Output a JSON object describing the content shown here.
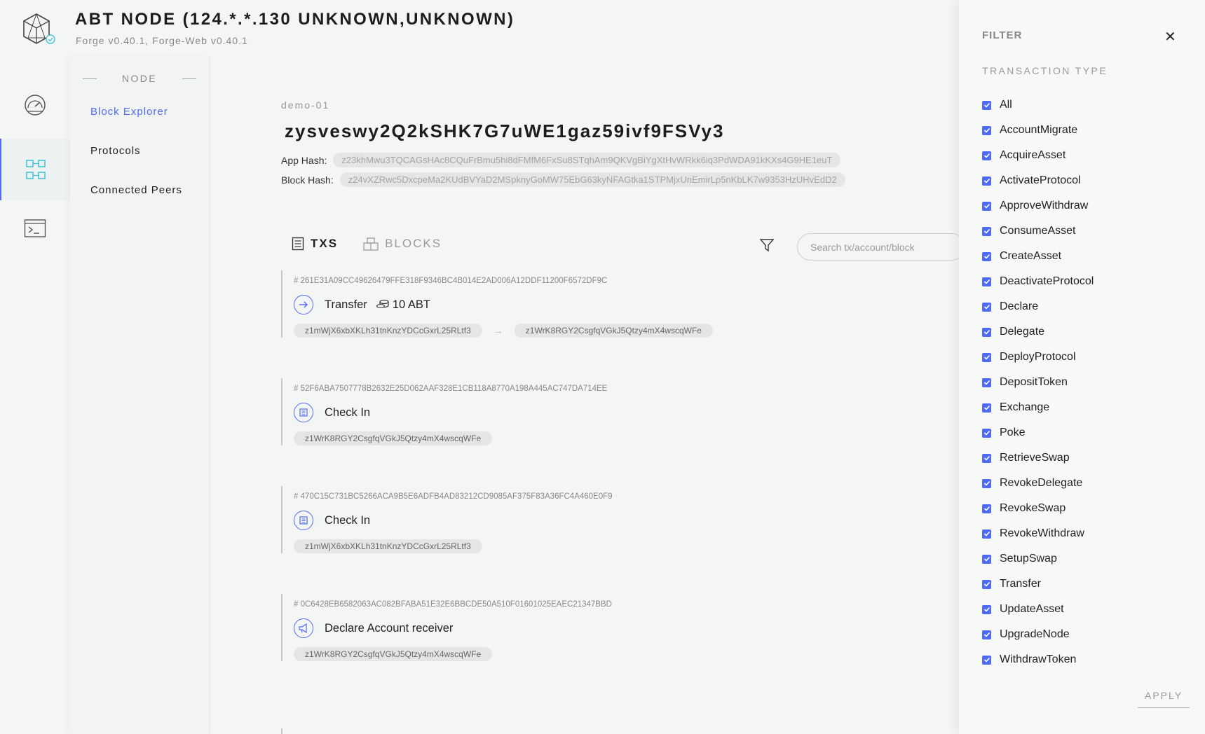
{
  "header": {
    "title": "ABT NODE (124.*.*.130 UNKNOWN,UNKNOWN)",
    "subtitle": "Forge v0.40.1, Forge-Web v0.40.1",
    "logo_icon": "abt-cube-logo"
  },
  "rail": [
    {
      "icon": "dashboard-gauge-icon",
      "active": false
    },
    {
      "icon": "node-grid-icon",
      "active": true
    },
    {
      "icon": "terminal-icon",
      "active": false
    }
  ],
  "sidebar": {
    "heading": "NODE",
    "items": [
      {
        "label": "Block Explorer",
        "active": true
      },
      {
        "label": "Protocols",
        "active": false
      },
      {
        "label": "Connected Peers",
        "active": false
      }
    ]
  },
  "main": {
    "network": "demo-01",
    "node_id": "zysveswy2Q2kSHK7G7uWE1gaz59ivf9FSVy3",
    "app_hash_label": "App Hash:",
    "app_hash": "z23khMwu3TQCAGsHAc8CQuFrBmu5hi8dFMfM6FxSu8STqhAm9QKVgBiYgXtHvWRkk6iq3PdWDA91kKXs4G9HE1euT",
    "block_hash_label": "Block Hash:",
    "block_hash": "z24vXZRwc5DxcpeMa2KUdBVYaD2MSpknyGoMW75EbG63kyNFAGtka1STPMjxUnEmirLp5nKbLK7w9353HzUHvEdD2",
    "tabs": [
      {
        "label": "TXS",
        "active": true
      },
      {
        "label": "BLOCKS",
        "active": false
      }
    ],
    "search_placeholder": "Search tx/account/block",
    "transactions": [
      {
        "hash": "# 261E31A09CC49626479FFE318F9346BC4B014E2AD006A12DDF11200F6572DF9C",
        "type": "Transfer",
        "icon": "transfer-arrow-icon",
        "amount": "10 ABT",
        "from": "z1mWjX6xbXKLh31tnKnzYDCcGxrL25RLtf3",
        "to": "z1WrK8RGY2CsgfqVGkJ5Qtzy4mX4wscqWFe"
      },
      {
        "hash": "# 52F6ABA7507778B2632E25D062AAF328E1CB118A8770A198A445AC747DA714EE",
        "type": "Check In",
        "icon": "checkin-icon",
        "amount": "",
        "from": "z1WrK8RGY2CsgfqVGkJ5Qtzy4mX4wscqWFe",
        "to": ""
      },
      {
        "hash": "# 470C15C731BC5266ACA9B5E6ADFB4AD83212CD9085AF375F83A36FC4A460E0F9",
        "type": "Check In",
        "icon": "checkin-icon",
        "amount": "",
        "from": "z1mWjX6xbXKLh31tnKnzYDCcGxrL25RLtf3",
        "to": ""
      },
      {
        "hash": "# 0C6428EB6582063AC082BFABA51E32E6BBCDE50A510F01601025EAEC21347BBD",
        "type": "Declare Account receiver",
        "icon": "megaphone-icon",
        "amount": "",
        "from": "z1WrK8RGY2CsgfqVGkJ5Qtzy4mX4wscqWFe",
        "to": ""
      }
    ]
  },
  "filter": {
    "title": "FILTER",
    "section": "TRANSACTION TYPE",
    "apply_label": "APPLY",
    "accent": "#4e6af6",
    "options": [
      {
        "label": "All",
        "checked": true
      },
      {
        "label": "AccountMigrate",
        "checked": true
      },
      {
        "label": "AcquireAsset",
        "checked": true
      },
      {
        "label": "ActivateProtocol",
        "checked": true
      },
      {
        "label": "ApproveWithdraw",
        "checked": true
      },
      {
        "label": "ConsumeAsset",
        "checked": true
      },
      {
        "label": "CreateAsset",
        "checked": true
      },
      {
        "label": "DeactivateProtocol",
        "checked": true
      },
      {
        "label": "Declare",
        "checked": true
      },
      {
        "label": "Delegate",
        "checked": true
      },
      {
        "label": "DeployProtocol",
        "checked": true
      },
      {
        "label": "DepositToken",
        "checked": true
      },
      {
        "label": "Exchange",
        "checked": true
      },
      {
        "label": "Poke",
        "checked": true
      },
      {
        "label": "RetrieveSwap",
        "checked": true
      },
      {
        "label": "RevokeDelegate",
        "checked": true
      },
      {
        "label": "RevokeSwap",
        "checked": true
      },
      {
        "label": "RevokeWithdraw",
        "checked": true
      },
      {
        "label": "SetupSwap",
        "checked": true
      },
      {
        "label": "Transfer",
        "checked": true
      },
      {
        "label": "UpdateAsset",
        "checked": true
      },
      {
        "label": "UpgradeNode",
        "checked": true
      },
      {
        "label": "WithdrawToken",
        "checked": true
      }
    ]
  }
}
